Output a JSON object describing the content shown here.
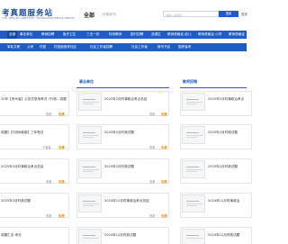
{
  "header": {
    "logo_title": "考真题服务站",
    "logo_subtitle": "CIVIL SERVANT COMPETENCY EXAMINATION SERVICE WEBSITE",
    "region": "全部",
    "region_switch": "[切换城市]",
    "search_placeholder": "请输入关键词",
    "search_button": "搜索",
    "login": "登录"
  },
  "nav_primary": [
    {
      "label": "全部",
      "active": true
    },
    {
      "label": "事业单位"
    },
    {
      "label": "教师招聘"
    },
    {
      "label": "医疗卫生"
    },
    {
      "label": "三支一扶"
    },
    {
      "label": "特岗教师"
    },
    {
      "label": "银行招聘"
    },
    {
      "label": "选调生"
    },
    {
      "label": "教师资格证-幼儿"
    },
    {
      "label": "教师资格证-小学"
    },
    {
      "label": "教师资格证"
    }
  ],
  "nav_secondary": [
    {
      "label": "军队文职"
    },
    {
      "label": "公考"
    },
    {
      "label": "村居"
    },
    {
      "label": "村官面视考社区"
    },
    {
      "label": "社区工作者招聘"
    },
    {
      "label": "社会工作者"
    },
    {
      "label": "新华书店"
    },
    {
      "label": "国考省考"
    }
  ],
  "sections": {
    "left_head": "",
    "middle_head": "事业单位",
    "right_head": "教师招聘"
  },
  "left_cards": [
    {
      "title": "20年【贵州省】公务员录用考试《行政...真题",
      "views": "查看",
      "badge": "免费"
    },
    {
      "title": "真题】【行测B卷卷】三年笔试",
      "views": "下载量",
      "badge": "免费"
    },
    {
      "title": "2025年2月时事政治考点总结",
      "views": "查看",
      "badge": "免费"
    },
    {
      "title": "2025年2月时政试题",
      "views": "查看",
      "badge": "免费"
    },
    {
      "title": "真题汇总-申论",
      "views": "查看",
      "badge": "免费"
    }
  ],
  "middle_cards": [
    {
      "title": "2025年2月时事政治考点总结",
      "views": "查看",
      "badge": "免费"
    },
    {
      "title": "2025年2月时政试题",
      "views": "查看",
      "badge": "免费"
    },
    {
      "title": "2025年2月时政试题",
      "views": "查看",
      "badge": "免费"
    },
    {
      "title": "2024年12月时事政治考点总结",
      "views": "查看",
      "badge": "免费"
    },
    {
      "title": "2024年12月时政试题",
      "views": "查看",
      "badge": "免费"
    },
    {
      "title": "2024年12月时政试题",
      "views": "查看",
      "badge": "免费"
    }
  ],
  "right_cards": [
    {
      "title": "2025年2月时事政治考点",
      "views": "查看",
      "badge": "免费"
    },
    {
      "title": "2025年2月时政试题",
      "views": "查看",
      "badge": "免费"
    },
    {
      "title": "2025年2月时政试题",
      "views": "查看",
      "badge": "免费"
    },
    {
      "title": "2024年12月时事政治",
      "views": "查看",
      "badge": "免费"
    },
    {
      "title": "2024年12月时政试题",
      "views": "查看",
      "badge": "免费"
    },
    {
      "title": "2024年12月时政试题",
      "views": "查看",
      "badge": "免费"
    }
  ],
  "colors": {
    "brand_blue": "#1e5ec2",
    "free_orange": "#f08c1a"
  }
}
